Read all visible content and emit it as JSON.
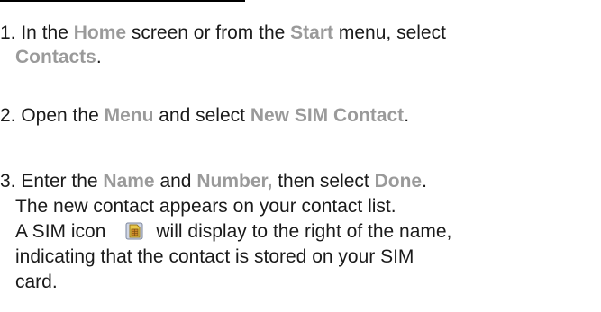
{
  "colors": {
    "text": "#1a1a1a",
    "highlight": "#9a9a9a",
    "rule": "#000000"
  },
  "steps": [
    {
      "lines": [
        {
          "segments": [
            {
              "text": "1. In the ",
              "hl": false
            },
            {
              "text": "Home",
              "hl": true
            },
            {
              "text": " screen or from the ",
              "hl": false
            },
            {
              "text": "Start",
              "hl": true
            },
            {
              "text": " menu, select",
              "hl": false
            }
          ]
        },
        {
          "segments": [
            {
              "text": "Contacts",
              "hl": true
            },
            {
              "text": ".",
              "hl": false
            }
          ]
        }
      ]
    },
    {
      "lines": [
        {
          "segments": [
            {
              "text": "2. Open the ",
              "hl": false
            },
            {
              "text": "Menu",
              "hl": true
            },
            {
              "text": " and select ",
              "hl": false
            },
            {
              "text": "New SIM Contact",
              "hl": true
            },
            {
              "text": ".",
              "hl": false
            }
          ]
        }
      ]
    },
    {
      "lines": [
        {
          "segments": [
            {
              "text": "3. Enter the ",
              "hl": false
            },
            {
              "text": "Name",
              "hl": true
            },
            {
              "text": " and ",
              "hl": false
            },
            {
              "text": "Number,",
              "hl": true
            },
            {
              "text": " then select ",
              "hl": false
            },
            {
              "text": "Done",
              "hl": true
            },
            {
              "text": ".",
              "hl": false
            }
          ]
        },
        {
          "segments": [
            {
              "text": "The new contact appears on your contact list.",
              "hl": false
            }
          ]
        },
        {
          "segments": [
            {
              "text": "A SIM icon",
              "hl": false
            },
            {
              "icon": "sim-card-icon"
            },
            {
              "text": "will display to the right of the name,",
              "hl": false
            }
          ]
        },
        {
          "segments": [
            {
              "text": "indicating that the contact is stored on your SIM",
              "hl": false
            }
          ]
        },
        {
          "segments": [
            {
              "text": "card.",
              "hl": false
            }
          ]
        }
      ]
    }
  ]
}
